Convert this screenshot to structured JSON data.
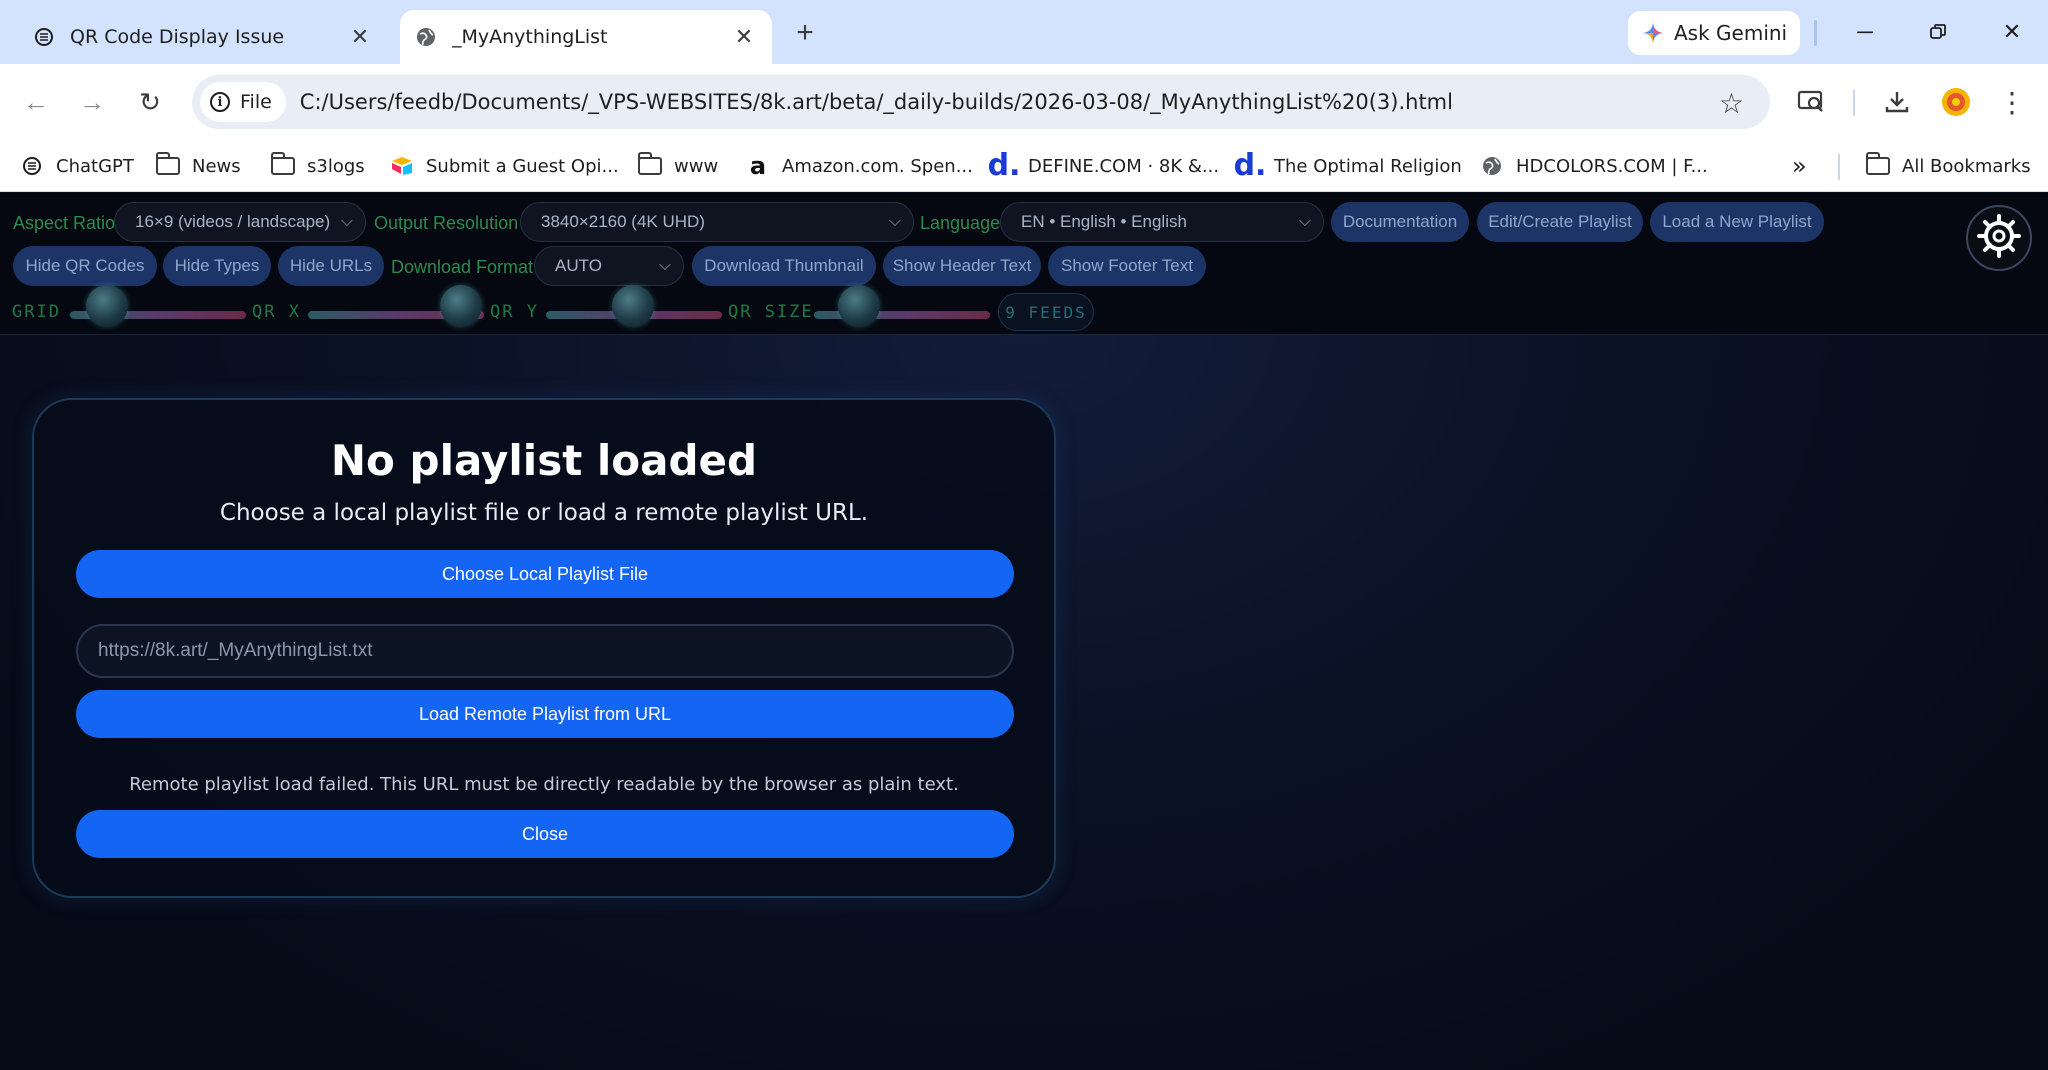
{
  "browser": {
    "tabs": [
      {
        "title": "QR Code Display Issue",
        "icon": "chatgpt-icon"
      },
      {
        "title": "_MyAnythingList",
        "icon": "globe-icon"
      }
    ],
    "gemini_label": "Ask Gemini",
    "site_chip": "File",
    "url": "C:/Users/feedb/Documents/_VPS-WEBSITES/8k.art/beta/_daily-builds/2026-03-08/_MyAnythingList%20(3).html"
  },
  "bookmarks": {
    "items": [
      {
        "label": "ChatGPT",
        "icon": "chatgpt-icon"
      },
      {
        "label": "News",
        "icon": "folder-icon"
      },
      {
        "label": "s3logs",
        "icon": "folder-icon"
      },
      {
        "label": "Submit a Guest Opi...",
        "icon": "airtable-icon"
      },
      {
        "label": "www",
        "icon": "folder-icon"
      },
      {
        "label": "Amazon.com. Spen...",
        "icon": "amazon-icon"
      },
      {
        "label": "DEFINE.COM · 8K &...",
        "icon": "define-icon"
      },
      {
        "label": "The Optimal Religion",
        "icon": "define-icon"
      },
      {
        "label": "HDCOLORS.COM | F...",
        "icon": "globe-icon"
      }
    ],
    "overflow": "»",
    "all_label": "All Bookmarks"
  },
  "controls": {
    "aspect_ratio_label": "Aspect Ratio",
    "aspect_ratio_value": "16×9 (videos / landscape)",
    "output_resolution_label": "Output Resolution",
    "output_resolution_value": "3840×2160 (4K UHD)",
    "language_label": "Language",
    "language_value": "EN • English • English",
    "documentation": "Documentation",
    "edit_playlist": "Edit/Create Playlist",
    "load_playlist": "Load a New Playlist",
    "hide_qr": "Hide QR Codes",
    "hide_types": "Hide Types",
    "hide_urls": "Hide URLs",
    "download_format_label": "Download Format",
    "download_format_value": "AUTO",
    "download_thumbnail": "Download Thumbnail",
    "show_header": "Show Header Text",
    "show_footer": "Show Footer Text",
    "sliders": [
      {
        "label": "GRID"
      },
      {
        "label": "QR X"
      },
      {
        "label": "QR Y"
      },
      {
        "label": "QR SIZE"
      }
    ],
    "feeds": "9 FEEDS"
  },
  "dialog": {
    "title": "No playlist loaded",
    "subtitle": "Choose a local playlist file or load a remote playlist URL.",
    "choose_local": "Choose Local Playlist File",
    "url_value": "https://8k.art/_MyAnythingList.txt",
    "load_remote": "Load Remote Playlist from URL",
    "message": "Remote playlist load failed. This URL must be directly readable by the browser as plain text.",
    "close": "Close"
  },
  "colors": {
    "accent": "#1565f5",
    "label_green": "#2c8a4e",
    "pill_bg": "#1c3566"
  }
}
